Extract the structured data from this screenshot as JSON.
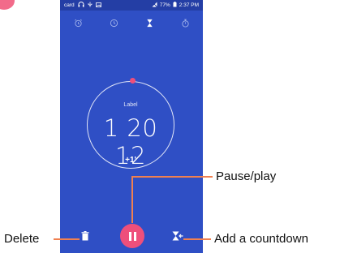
{
  "status_bar": {
    "carrier": "card",
    "battery": "77%",
    "time": "2:37 PM"
  },
  "tabs": [
    {
      "icon": "alarm-icon"
    },
    {
      "icon": "clock-icon"
    },
    {
      "icon": "hourglass-icon",
      "active": true
    },
    {
      "icon": "stopwatch-icon"
    }
  ],
  "timer": {
    "label": "Label",
    "time": "1 20 12",
    "add_minute": "+1'"
  },
  "callouts": {
    "pause_play": "Pause/play",
    "delete": "Delete",
    "add_countdown": "Add a countdown"
  },
  "colors": {
    "background": "#2f4fc5",
    "status_bar": "#243ea5",
    "accent": "#ee4f7b",
    "callout_line": "#f08050"
  }
}
